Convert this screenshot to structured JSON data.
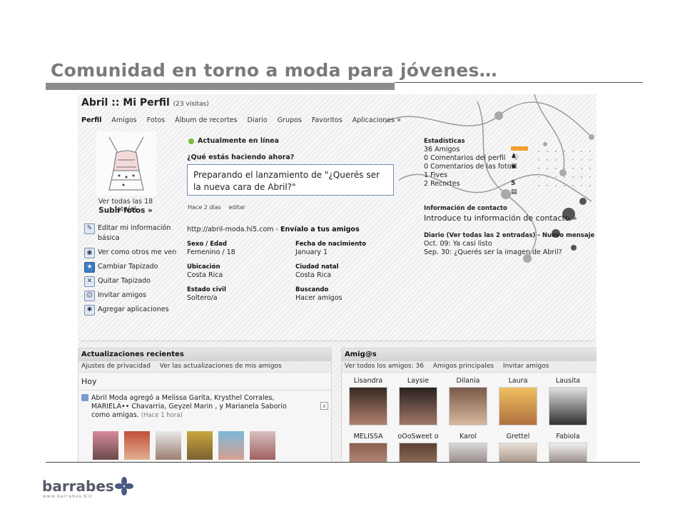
{
  "slide": {
    "title": "Comunidad en torno a moda para jóvenes…",
    "footer_brand": "barrabes",
    "footer_url": "www.barrabes.biz"
  },
  "profile": {
    "title": "Abril :: Mi Perfil",
    "visits": "(23 visitas)",
    "nav": [
      "Perfil",
      "Amigos",
      "Fotos",
      "Álbum de recortes",
      "Diario",
      "Grupos",
      "Favoritos",
      "Aplicaciones »"
    ],
    "photo_caption": "Ver todas las 18 foto(s)",
    "photo_link": "Subir fotos »",
    "actions": [
      {
        "icon": "pencil-icon",
        "label": "Editar mi información básica"
      },
      {
        "icon": "eye-icon",
        "label": "Ver como otros me ven"
      },
      {
        "icon": "star-icon",
        "label": "Cambiar Tapizado"
      },
      {
        "icon": "remove-icon",
        "label": "Quitar Tapizado"
      },
      {
        "icon": "invite-icon",
        "label": "Invitar amigos"
      },
      {
        "icon": "apps-icon",
        "label": "Agregar aplicaciones"
      }
    ],
    "online_status": "Actualmente en línea",
    "question": "¿Qué estás haciendo ahora?",
    "status_text": "Preparando el lanzamiento de \"¿Querés ser la nueva cara de Abril?\"",
    "status_time": "Hace 2 días",
    "status_edit": "editar",
    "url": "http://abril-moda.hi5.com - ",
    "url_action": "Envíalo a tus amigos",
    "fields": [
      {
        "label": "Sexo / Edad",
        "value": "Femenino /  18"
      },
      {
        "label": "Fecha de nacimiento",
        "value": "January 1"
      },
      {
        "label": "Ubicación",
        "value": "Costa Rica"
      },
      {
        "label": "Ciudad natal",
        "value": "Costa Rica"
      },
      {
        "label": "Estado civil",
        "value": "Soltero/a"
      },
      {
        "label": "Buscando",
        "value": "Hacer amigos"
      }
    ],
    "stats_header": "Estadísticas",
    "stats": [
      "36 Amigos",
      "0 Comentarios del perfil",
      "0 Comentarios de las fotos",
      "1 Fives",
      "2 Recortes"
    ],
    "fives_count": "5",
    "contact_header": "Información de contacto",
    "contact_link": "Introduce tu información de contacto »",
    "diary_header": "Diario (",
    "diary_all": "Ver todas las 2 entradas",
    "diary_new": ") - Nuevo mensaje",
    "diary_entries": [
      "Oct. 09: Ya casi listo",
      "Sep. 30: ¿Querés ser la imagen de Abril?"
    ]
  },
  "updates": {
    "header": "Actualizaciones recientes",
    "links": [
      "Ajustes de privacidad",
      "Ver las actualizaciones de mis amigos"
    ],
    "today": "Hoy",
    "item_text": "Abril Moda agregó a Melissa Garita, Krysthel Corrales, MARIELA•• Chavarria, Geyzel Marin , y Marianela Saborio como amigas.",
    "item_time": "(Hace 1 hora)",
    "close": "x"
  },
  "friends": {
    "header": "Amig@s",
    "links": [
      "Ver todos los amigos: 36",
      "Amigos principales",
      "Invitar amigos"
    ],
    "names": [
      "Lisandra",
      "Laysie",
      "Dilania",
      "Laura",
      "Lausita",
      "MELISSA",
      "oOoSweet o",
      "Karol",
      "Grettel",
      "Fabiola"
    ]
  }
}
